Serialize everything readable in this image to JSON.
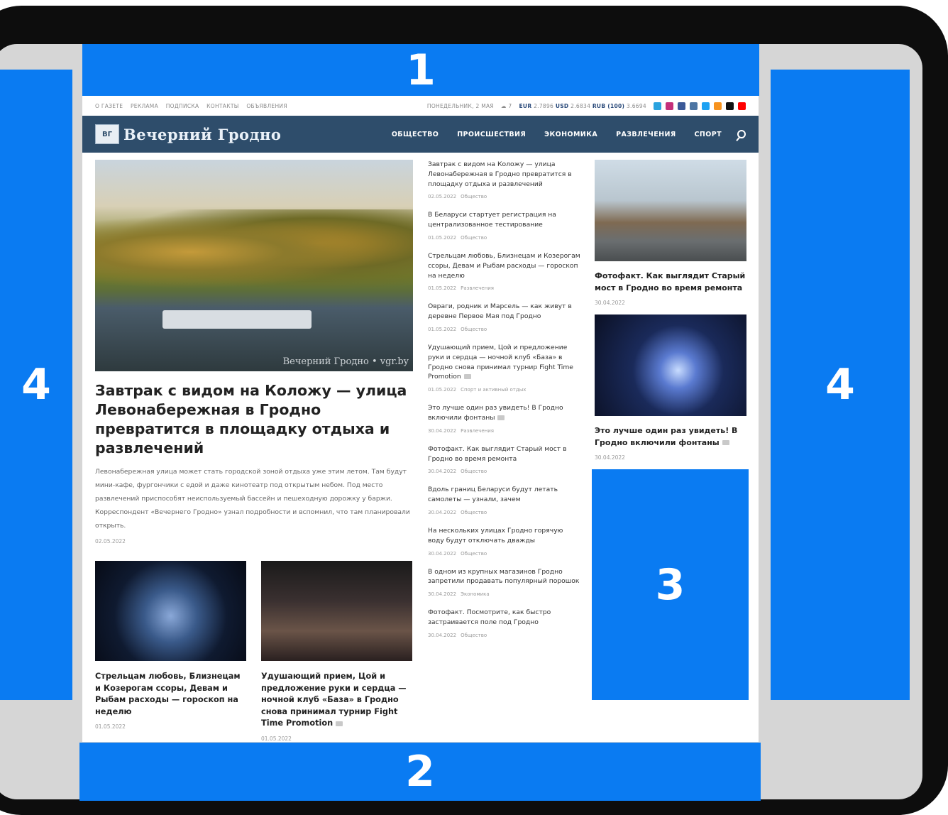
{
  "zones": {
    "top": "1",
    "bottom": "2",
    "right_block": "3",
    "side_left": "4",
    "side_right": "4"
  },
  "topbar": {
    "links": [
      "О ГАЗЕТЕ",
      "РЕКЛАМА",
      "ПОДПИСКА",
      "КОНТАКТЫ",
      "ОБЪЯВЛЕНИЯ"
    ],
    "date": "ПОНЕДЕЛЬНИК, 2 МАЯ",
    "temp": "7",
    "eur_label": "EUR",
    "eur": "2.7896",
    "usd_label": "USD",
    "usd": "2.6834",
    "rub_label": "RUB (100)",
    "rub": "3.6694",
    "socials": [
      "telegram-icon",
      "instagram-icon",
      "facebook-icon",
      "vk-icon",
      "twitter-icon",
      "ok-icon",
      "tiktok-icon",
      "youtube-icon"
    ],
    "social_colors": [
      "#2aa3df",
      "#c4307a",
      "#3b5998",
      "#4c75a3",
      "#1da1f2",
      "#f7931e",
      "#111111",
      "#ff0000"
    ]
  },
  "nav": {
    "logo_mark": "ВГ",
    "logo_text": "Вечерний Гродно",
    "menu": [
      "ОБЩЕСТВО",
      "ПРОИСШЕСТВИЯ",
      "ЭКОНОМИКА",
      "РАЗВЛЕЧЕНИЯ",
      "СПОРТ"
    ]
  },
  "hero": {
    "watermark": "Вечерний Гродно • vgr.by",
    "title": "Завтрак с видом на Коложу — улица Левонабережная в Гродно превратится в площадку отдыха и развлечений",
    "desc": "Левонабережная улица может стать городской зоной отдыха уже этим летом. Там будут мини-кафе, фургончики с едой и даже кинотеатр под открытым небом. Под место развлечений приспособят неиспользуемый бассейн и пешеходную дорожку у баржи. Корреспондент «Вечернего Гродно» узнал подробности и вспомнил, что там планировали открыть.",
    "date": "02.05.2022"
  },
  "cards": [
    {
      "title": "Стрельцам любовь, Близнецам и Козерогам ссоры, Девам и Рыбам расходы — гороскоп на неделю",
      "date": "01.05.2022"
    },
    {
      "title": "Удушающий прием, Цой и предложение руки и сердца — ночной клуб «База» в Гродно снова принимал турнир Fight Time Promotion",
      "date": "01.05.2022"
    }
  ],
  "feed": [
    {
      "title": "Завтрак с видом на Коложу — улица Левонабережная в Гродно превратится в площадку отдыха и развлечений",
      "date": "02.05.2022",
      "cat": "Общество"
    },
    {
      "title": "В Беларуси стартует регистрация на централизованное тестирование",
      "date": "01.05.2022",
      "cat": "Общество"
    },
    {
      "title": "Стрельцам любовь, Близнецам и Козерогам ссоры, Девам и Рыбам расходы — гороскоп на неделю",
      "date": "01.05.2022",
      "cat": "Развлечения"
    },
    {
      "title": "Овраги, родник и Марсель — как живут в деревне Первое Мая под Гродно",
      "date": "01.05.2022",
      "cat": "Общество"
    },
    {
      "title": "Удушающий прием, Цой и предложение руки и сердца — ночной клуб «База» в Гродно снова принимал турнир Fight Time Promotion",
      "date": "01.05.2022",
      "cat": "Спорт и активный отдых"
    },
    {
      "title": "Это лучше один раз увидеть! В Гродно включили фонтаны",
      "date": "30.04.2022",
      "cat": "Развлечения"
    },
    {
      "title": "Фотофакт. Как выглядит Старый мост в Гродно во время ремонта",
      "date": "30.04.2022",
      "cat": "Общество"
    },
    {
      "title": "Вдоль границ Беларуси будут летать самолеты — узнали, зачем",
      "date": "30.04.2022",
      "cat": "Общество"
    },
    {
      "title": "На нескольких улицах Гродно горячую воду будут отключать дважды",
      "date": "30.04.2022",
      "cat": "Общество"
    },
    {
      "title": "В одном из крупных магазинов Гродно запретили продавать популярный порошок",
      "date": "30.04.2022",
      "cat": "Экономика"
    },
    {
      "title": "Фотофакт. Посмотрите, как быстро застраивается поле под Гродно",
      "date": "30.04.2022",
      "cat": "Общество"
    }
  ],
  "side": [
    {
      "title": "Фотофакт. Как выглядит Старый мост в Гродно во время ремонта",
      "date": "30.04.2022"
    },
    {
      "title": "Это лучше один раз увидеть! В Гродно включили фонтаны",
      "date": "30.04.2022"
    }
  ]
}
